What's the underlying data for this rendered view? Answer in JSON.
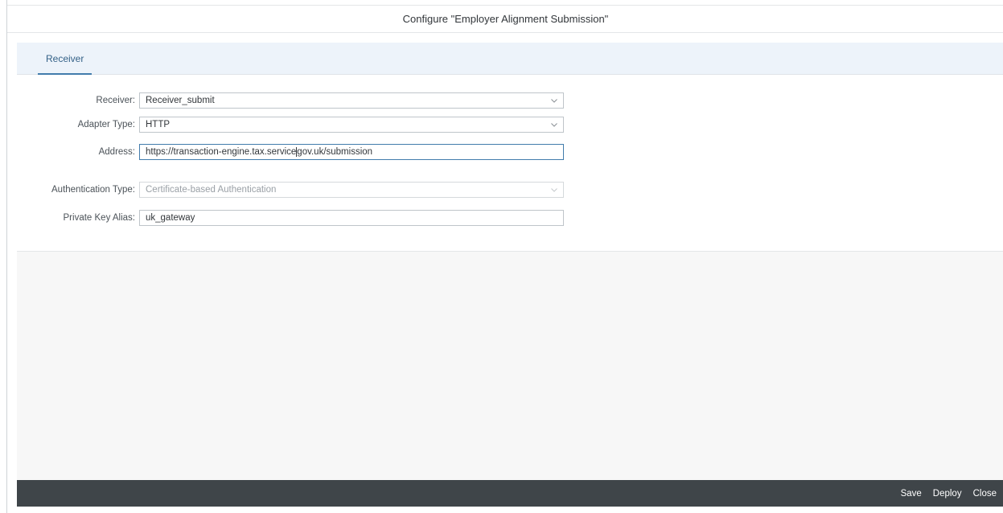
{
  "dialog": {
    "title": "Configure \"Employer Alignment Submission\""
  },
  "tabs": [
    {
      "label": "Receiver",
      "selected": true
    }
  ],
  "form": {
    "receiver": {
      "label": "Receiver:",
      "value": "Receiver_submit"
    },
    "adapter_type": {
      "label": "Adapter Type:",
      "value": "HTTP"
    },
    "address": {
      "label": "Address:",
      "value_before_cursor": "https://transaction-engine.tax.service",
      "value_after_cursor": "gov.uk/submission"
    },
    "authentication_type": {
      "label": "Authentication Type:",
      "value": "Certificate-based Authentication"
    },
    "private_key_alias": {
      "label": "Private Key Alias:",
      "value": "uk_gateway"
    }
  },
  "footer": {
    "save_label": "Save",
    "deploy_label": "Deploy",
    "close_label": "Close"
  },
  "colors": {
    "accent": "#427cac",
    "tabbar_bg": "#edf3fa",
    "footer_bg": "#3f4549"
  }
}
